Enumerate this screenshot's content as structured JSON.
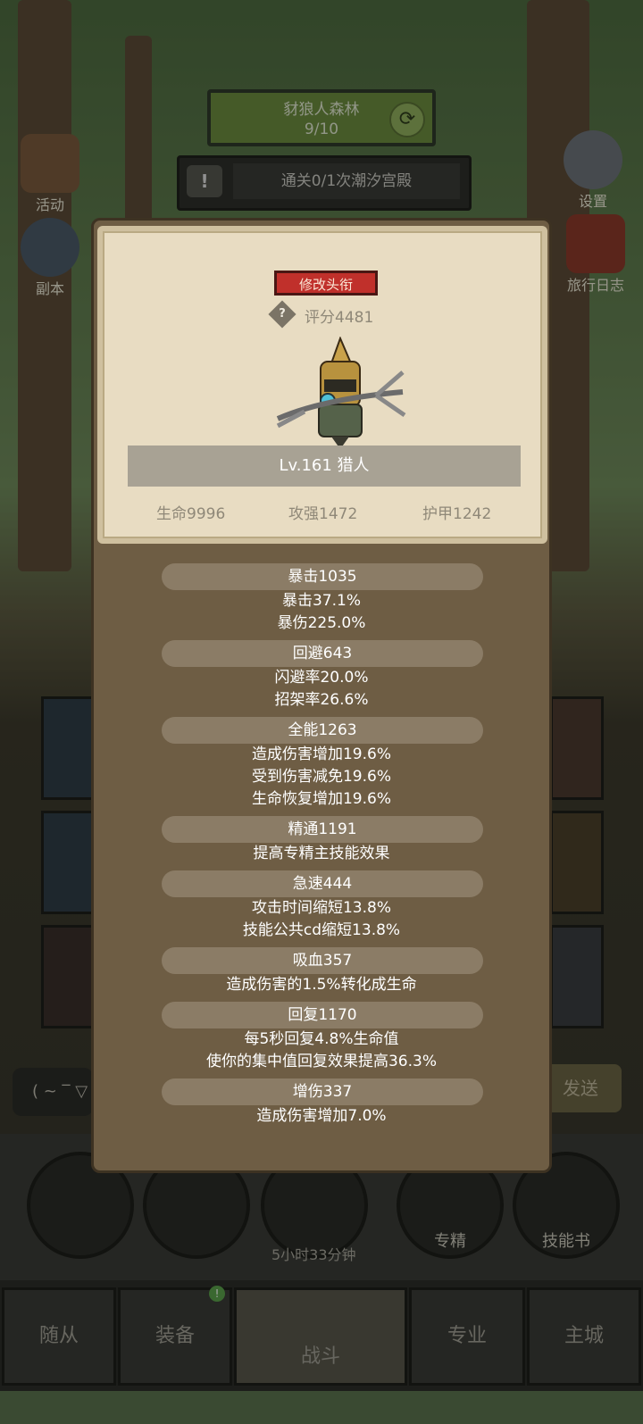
{
  "stage": {
    "name": "豺狼人森林",
    "progress": "9/10"
  },
  "quest": {
    "text": "通关0/1次潮汐宫殿"
  },
  "side_buttons": {
    "activity": "活动",
    "dungeon": "副本",
    "settings": "设置",
    "travel_log": "旅行日志"
  },
  "dialog": {
    "change_title_button": "修改头衔",
    "score": "评分4481",
    "level_class": "Lv.161 猎人",
    "hp": "生命9996",
    "attack": "攻强1472",
    "armor": "护甲1242",
    "stats": [
      {
        "header": "暴击1035",
        "lines": [
          "暴击37.1%",
          "暴伤225.0%"
        ]
      },
      {
        "header": "回避643",
        "lines": [
          "闪避率20.0%",
          "招架率26.6%"
        ]
      },
      {
        "header": "全能1263",
        "lines": [
          "造成伤害增加19.6%",
          "受到伤害减免19.6%",
          "生命恢复增加19.6%"
        ]
      },
      {
        "header": "精通1191",
        "lines": [
          "提高专精主技能效果"
        ]
      },
      {
        "header": "急速444",
        "lines": [
          "攻击时间缩短13.8%",
          "技能公共cd缩短13.8%"
        ]
      },
      {
        "header": "吸血357",
        "lines": [
          "造成伤害的1.5%转化成生命"
        ]
      },
      {
        "header": "回复1170",
        "lines": [
          "每5秒回复4.8%生命值",
          "使你的集中值回复效果提高36.3%"
        ]
      },
      {
        "header": "增伤337",
        "lines": [
          "造成伤害增加7.0%"
        ]
      }
    ]
  },
  "chat": {
    "input_text": "( ~ ‾ ▽",
    "send_label": "发送"
  },
  "bottom_buttons": {
    "specialization": "专精",
    "skill_book": "技能书",
    "timer": "5小时33分钟"
  },
  "tabs": [
    "随从",
    "装备",
    "战斗",
    "专业",
    "主城"
  ],
  "colors": {
    "title_button": "#c0302b",
    "panel": "#6e5d44",
    "card": "#e8dcc2"
  }
}
